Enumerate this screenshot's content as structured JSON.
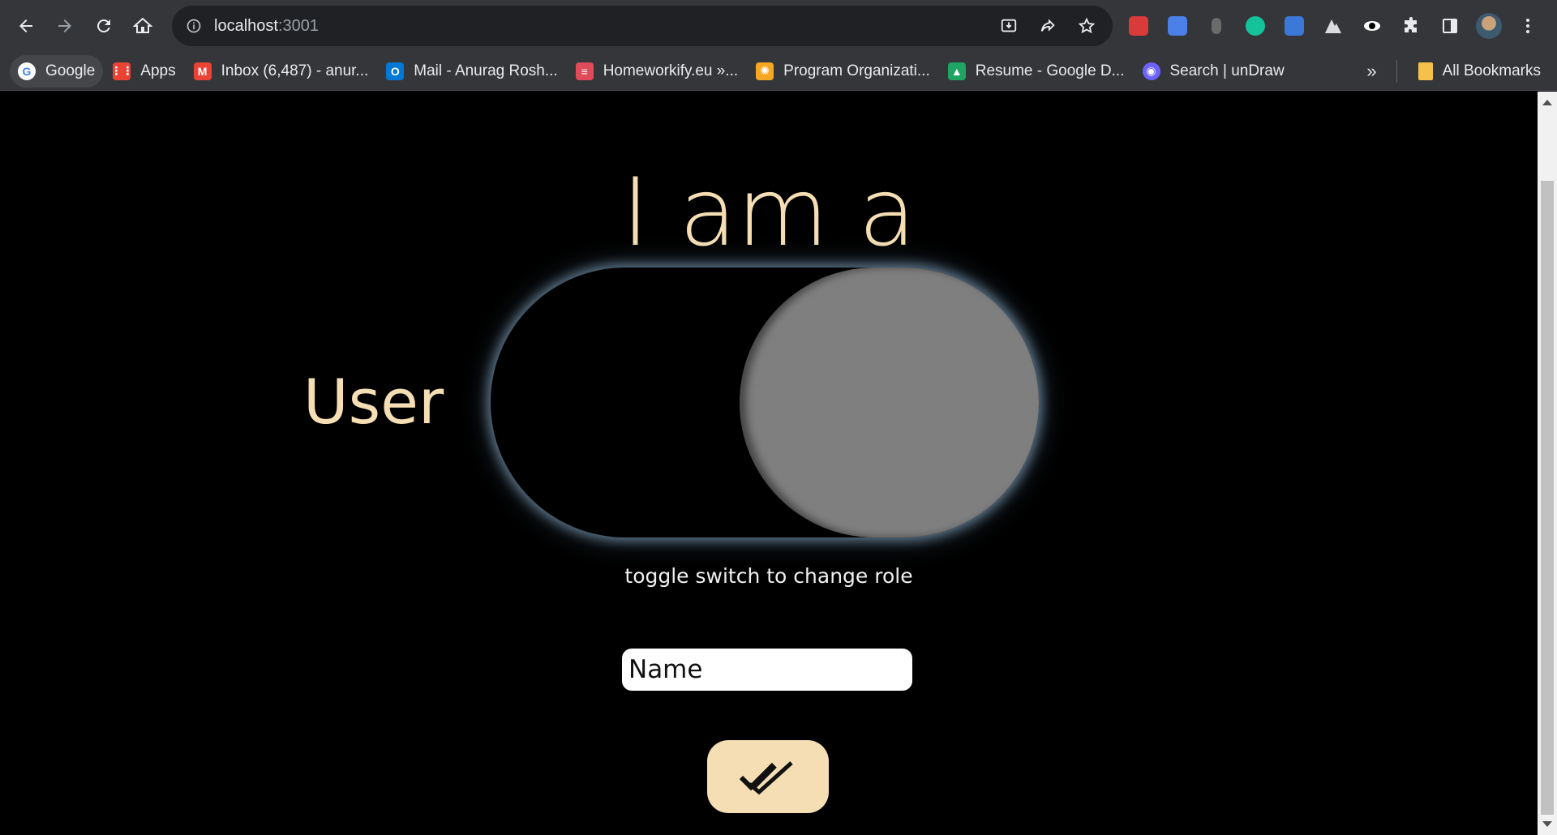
{
  "browser": {
    "url_host": "localhost",
    "url_port": ":3001"
  },
  "bookmarks": [
    {
      "label": "Google",
      "icon": "google-icon",
      "color": "#4285f4"
    },
    {
      "label": "Apps",
      "icon": "apps-grid-icon",
      "color": "#ea4335"
    },
    {
      "label": "Inbox (6,487) - anur...",
      "icon": "gmail-icon",
      "color": "#ea4335"
    },
    {
      "label": "Mail - Anurag Rosh...",
      "icon": "outlook-icon",
      "color": "#0078d4"
    },
    {
      "label": "Homeworkify.eu »...",
      "icon": "books-icon",
      "color": "#e04b5a"
    },
    {
      "label": "Program Organizati...",
      "icon": "gear-badge-icon",
      "color": "#f5a623"
    },
    {
      "label": "Resume - Google D...",
      "icon": "google-drive-icon",
      "color": "#1fa463"
    },
    {
      "label": "Search | unDraw",
      "icon": "undraw-icon",
      "color": "#6c63ff"
    }
  ],
  "bookmarks_overflow": "»",
  "all_bookmarks": "All Bookmarks",
  "page": {
    "heading": "I am a",
    "role_label": "User",
    "toggle_state": "off",
    "hint": "toggle switch to change role",
    "name_placeholder": "Name",
    "accent_color": "#f5deb3"
  }
}
